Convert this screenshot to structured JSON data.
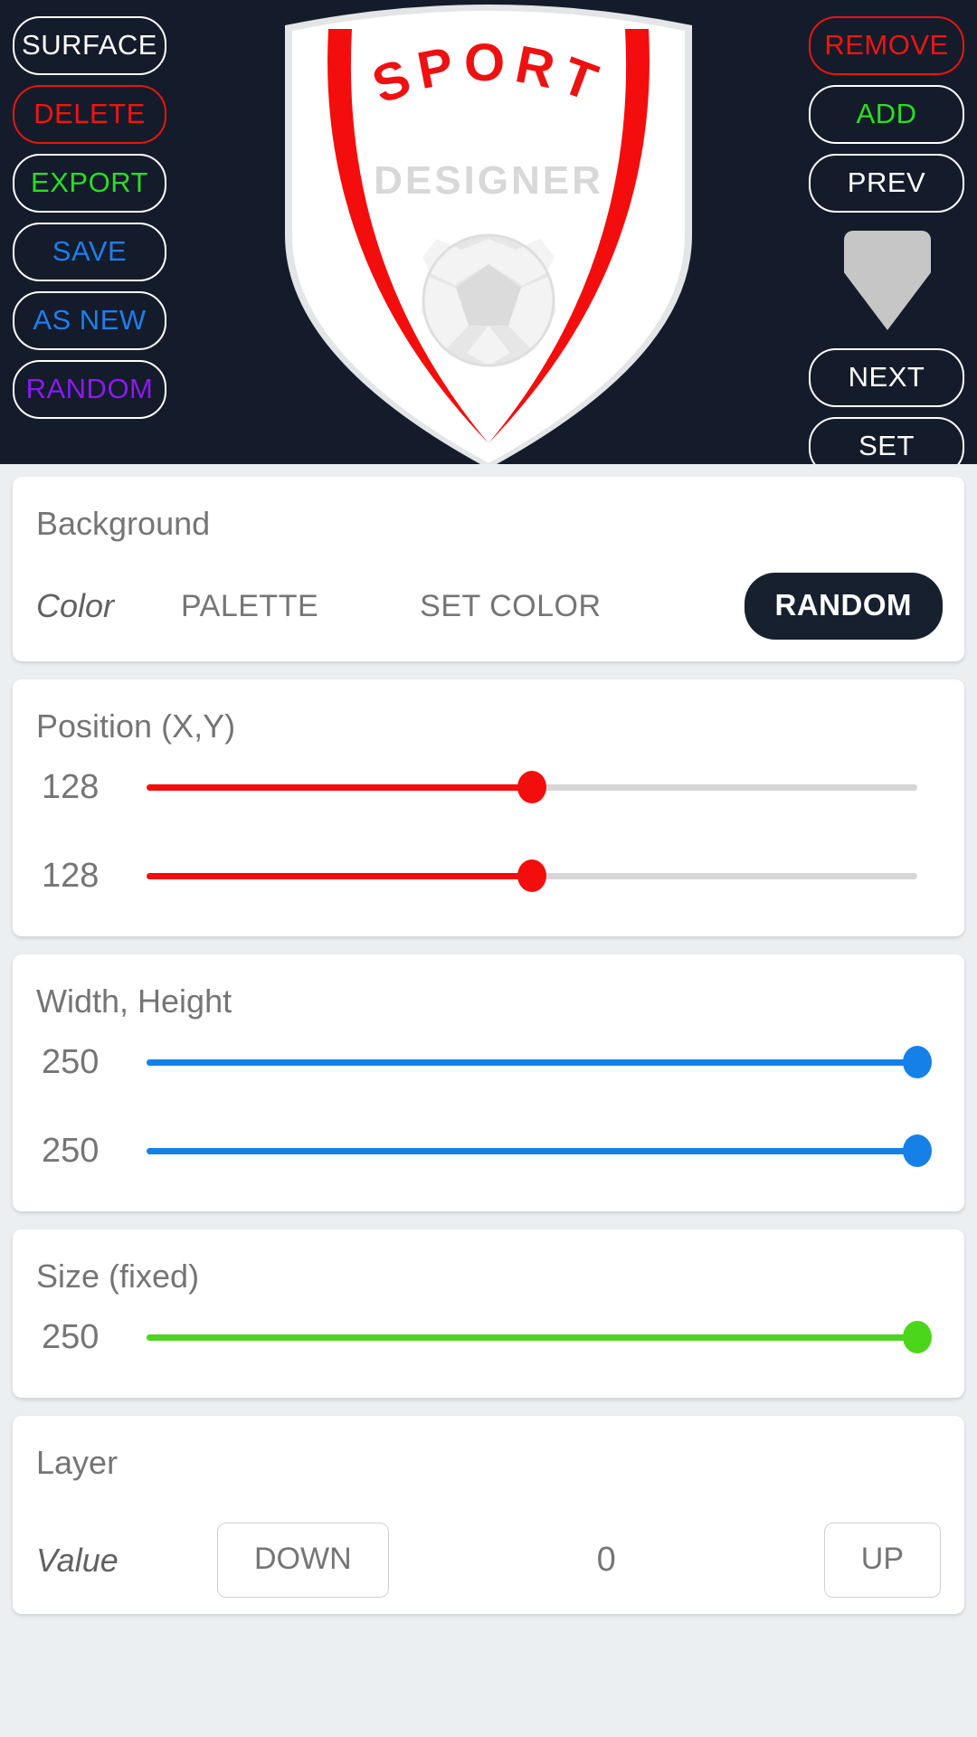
{
  "header": {
    "left_buttons": [
      {
        "label": "SURFACE",
        "style": "plain"
      },
      {
        "label": "DELETE",
        "style": "danger"
      },
      {
        "label": "EXPORT",
        "style": "success"
      },
      {
        "label": "SAVE",
        "style": "info"
      },
      {
        "label": "AS NEW",
        "style": "info"
      },
      {
        "label": "RANDOM",
        "style": "accent"
      }
    ],
    "right_buttons_top": [
      {
        "label": "REMOVE",
        "style": "danger"
      },
      {
        "label": "ADD",
        "style": "success"
      },
      {
        "label": "PREV",
        "style": "plain"
      }
    ],
    "right_buttons_bottom": [
      {
        "label": "NEXT",
        "style": "plain"
      },
      {
        "label": "SET",
        "style": "plain"
      }
    ],
    "logo": {
      "top_text": "SPORT",
      "sub_text": "DESIGNER",
      "stripe_color": "#f40d0d",
      "shield_color": "#ffffff",
      "sub_text_color": "#d8d8d8"
    },
    "background_color": "#141c2b",
    "thumbnail_color": "#c6c6c6"
  },
  "cards": {
    "background": {
      "title": "Background",
      "color_label": "Color",
      "palette_label": "PALETTE",
      "set_color_label": "SET COLOR",
      "random_label": "RANDOM",
      "random_bg": "#16202f"
    },
    "position": {
      "title": "Position (X,Y)",
      "accent": "#f40d0d",
      "sliders": [
        {
          "value": "128",
          "percent": 50
        },
        {
          "value": "128",
          "percent": 50
        }
      ]
    },
    "size_wh": {
      "title": "Width, Height",
      "accent": "#1581e8",
      "sliders": [
        {
          "value": "250",
          "percent": 100
        },
        {
          "value": "250",
          "percent": 100
        }
      ]
    },
    "size_fixed": {
      "title": "Size (fixed)",
      "accent": "#4bd61c",
      "sliders": [
        {
          "value": "250",
          "percent": 100
        }
      ]
    },
    "layer": {
      "title": "Layer",
      "value_label": "Value",
      "down_label": "DOWN",
      "value": "0",
      "up_label": "UP"
    }
  }
}
